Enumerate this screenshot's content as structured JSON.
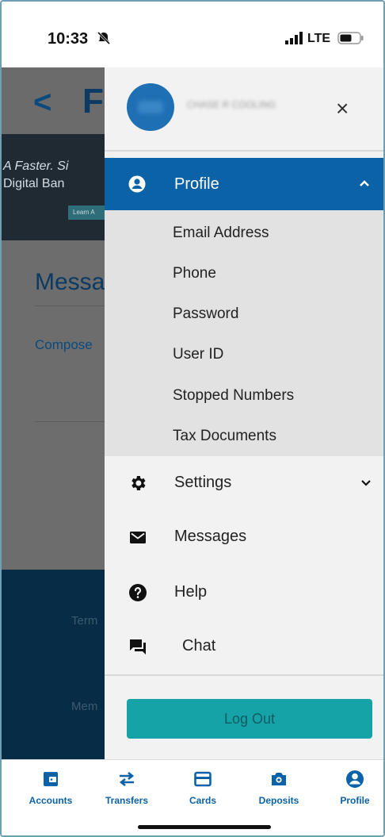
{
  "status_bar": {
    "time": "10:33",
    "network": "LTE"
  },
  "background_page": {
    "banner_line1": "A Faster. Si",
    "banner_line2": "Digital Ban",
    "banner_button": "Learn A",
    "section_title": "Messa",
    "compose_link": "Compose",
    "footer_link1": "Term",
    "footer_link2": "Mem"
  },
  "drawer": {
    "username": "CHASE R COOLING",
    "close_symbol": "×",
    "profile": {
      "label": "Profile",
      "items": [
        "Email Address",
        "Phone",
        "Password",
        "User ID",
        "Stopped Numbers",
        "Tax Documents"
      ]
    },
    "menu": [
      {
        "label": "Settings",
        "icon": "gear-icon"
      },
      {
        "label": "Messages",
        "icon": "envelope-icon"
      },
      {
        "label": "Help",
        "icon": "help-icon"
      },
      {
        "label": "Chat",
        "icon": "chat-icon"
      }
    ],
    "logout_label": "Log Out"
  },
  "tabbar": {
    "items": [
      {
        "label": "Accounts",
        "icon": "wallet-icon"
      },
      {
        "label": "Transfers",
        "icon": "transfer-arrows-icon"
      },
      {
        "label": "Cards",
        "icon": "card-icon"
      },
      {
        "label": "Deposits",
        "icon": "camera-icon"
      },
      {
        "label": "Profile",
        "icon": "user-circle-icon"
      }
    ]
  },
  "colors": {
    "primary": "#0b62a6",
    "accent": "#16a3a8",
    "submenu_bg": "#e2e2e2",
    "drawer_bg": "#f2f2f2"
  }
}
